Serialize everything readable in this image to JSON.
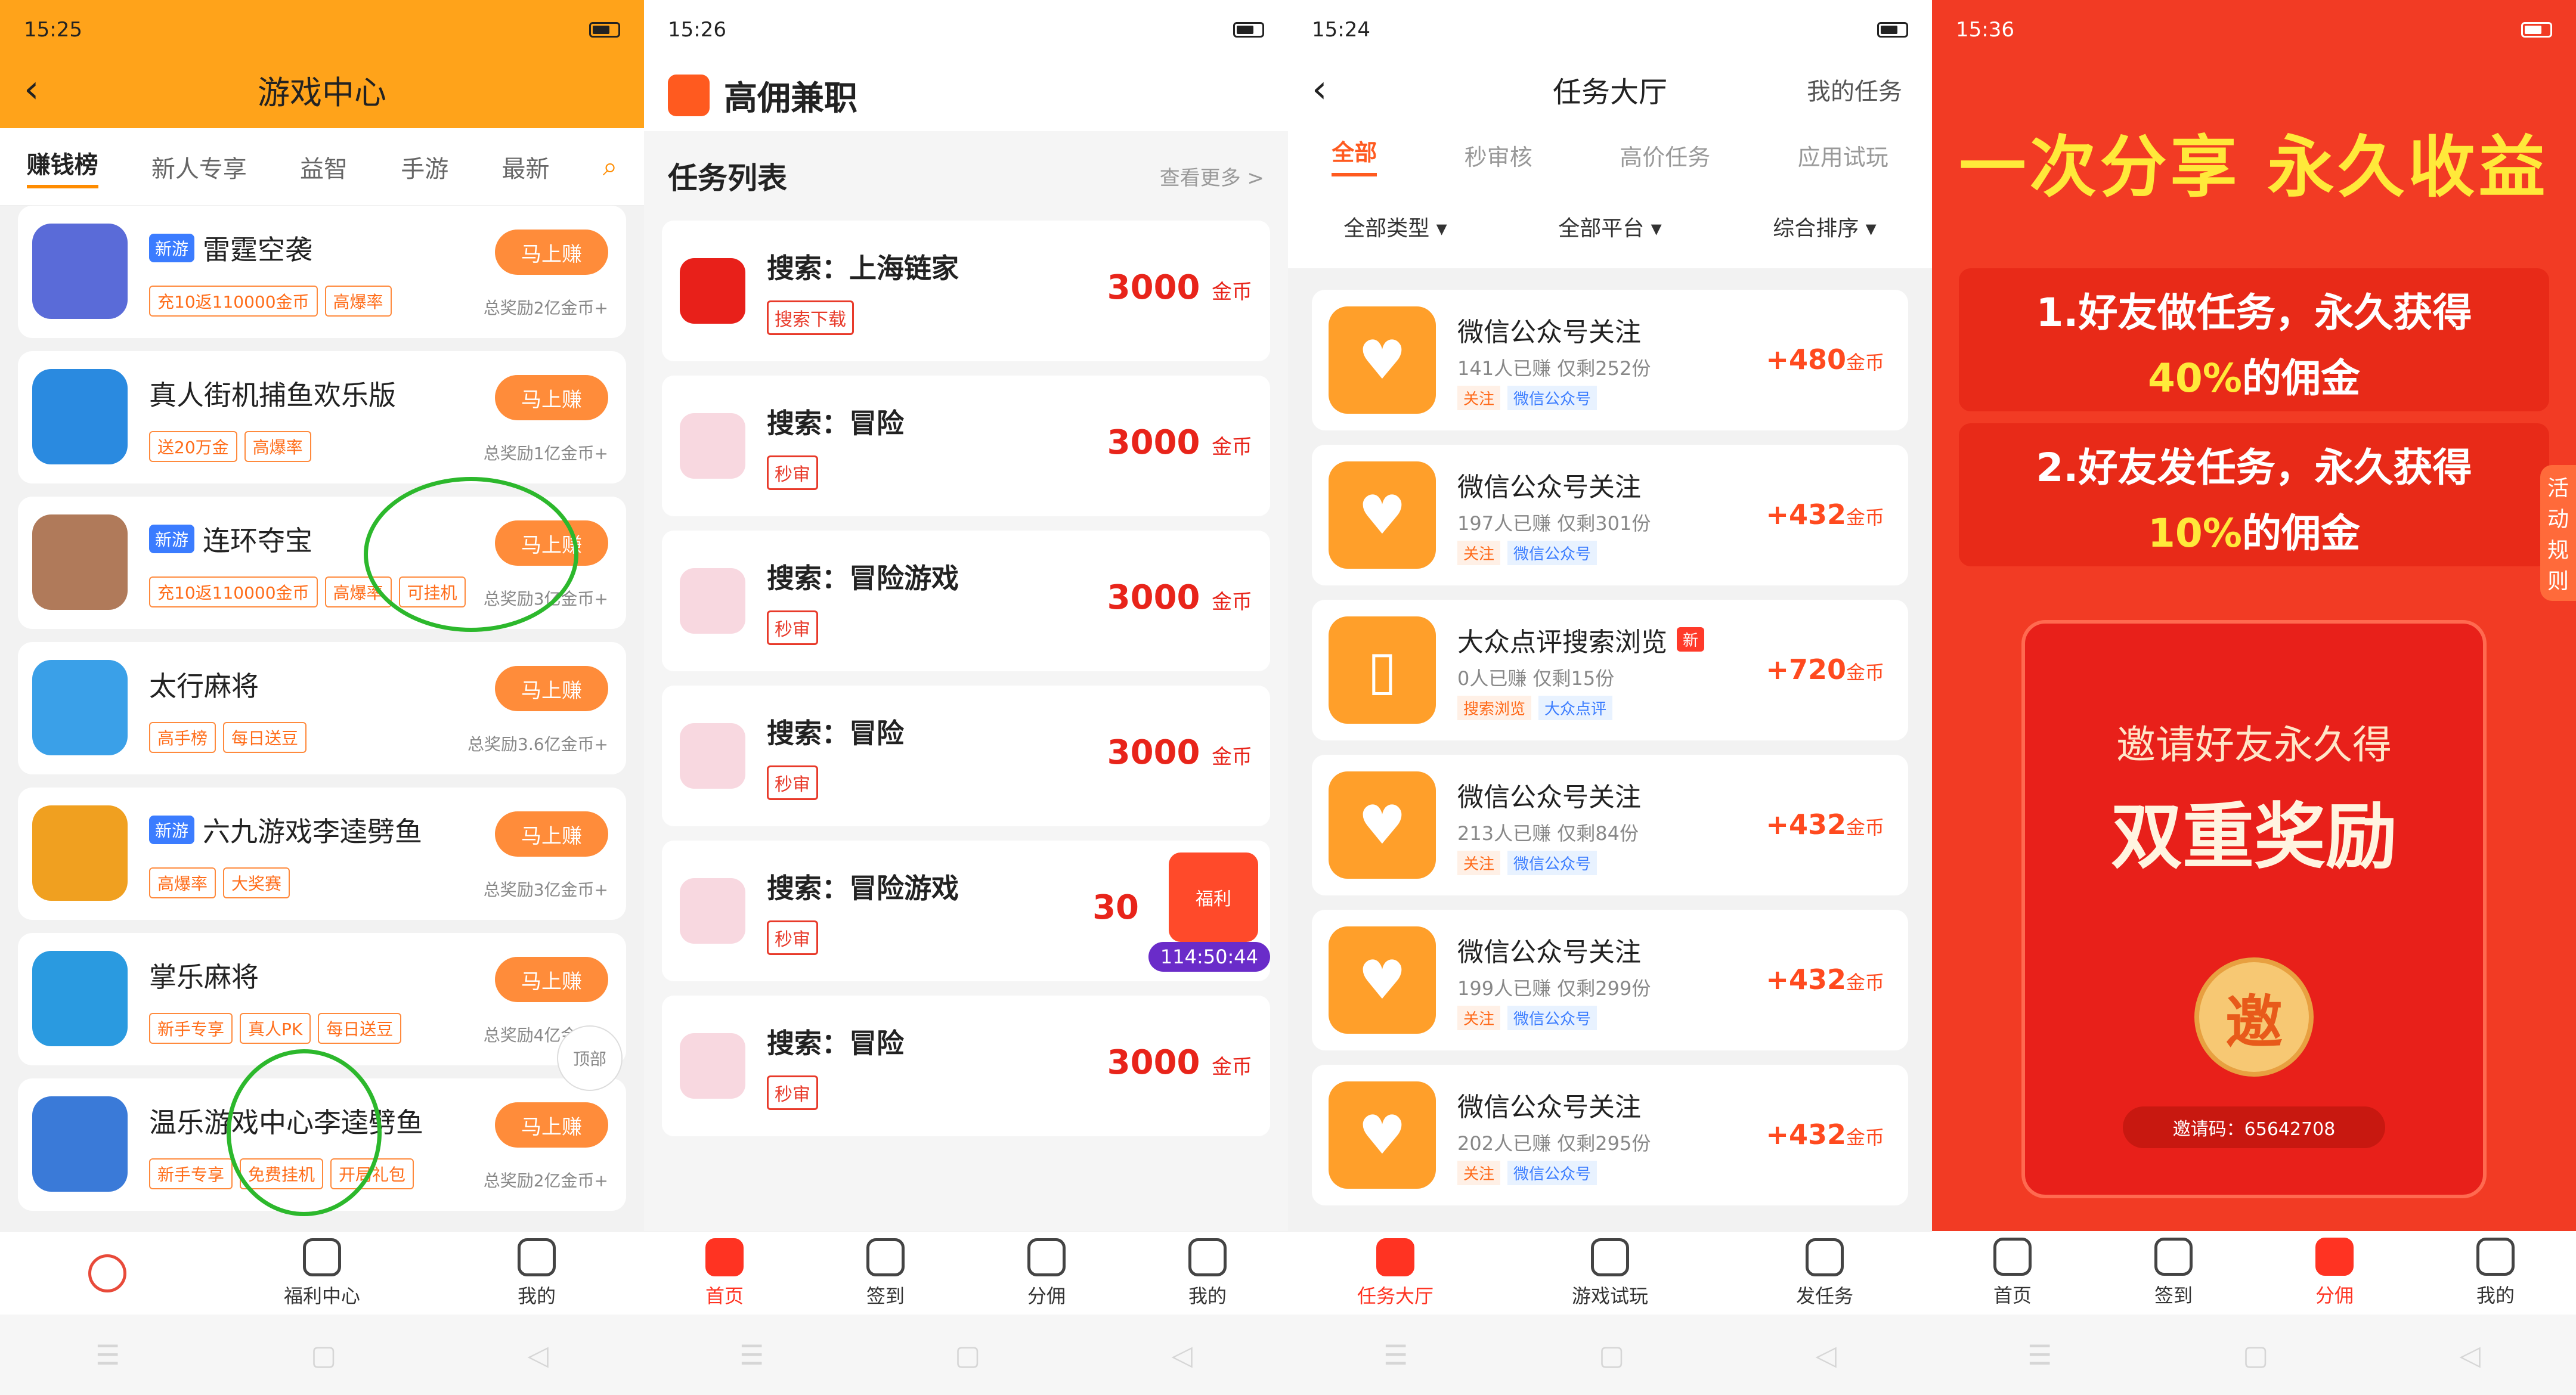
{
  "p1": {
    "status_time": "15:25",
    "title": "游戏中心",
    "tabs": [
      "赚钱榜",
      "新人专享",
      "益智",
      "手游",
      "最新"
    ],
    "games": [
      {
        "name": "雷霆空袭",
        "new": "新游",
        "tags": [
          "充10返110000金币",
          "高爆率"
        ],
        "btn": "马上赚",
        "total": "总奖励2亿金币+"
      },
      {
        "name": "真人街机捕鱼欢乐版",
        "new": "",
        "tags": [
          "送20万金",
          "高爆率"
        ],
        "btn": "马上赚",
        "total": "总奖励1亿金币+"
      },
      {
        "name": "连环夺宝",
        "new": "新游",
        "tags": [
          "充10返110000金币",
          "高爆率",
          "可挂机"
        ],
        "btn": "马上赚",
        "total": "总奖励3亿金币+"
      },
      {
        "name": "太行麻将",
        "new": "",
        "tags": [
          "高手榜",
          "每日送豆"
        ],
        "btn": "马上赚",
        "total": "总奖励3.6亿金币+"
      },
      {
        "name": "六九游戏李逵劈鱼",
        "new": "新游",
        "tags": [
          "高爆率",
          "大奖赛"
        ],
        "btn": "马上赚",
        "total": "总奖励3亿金币+"
      },
      {
        "name": "掌乐麻将",
        "new": "",
        "tags": [
          "新手专享",
          "真人PK",
          "每日送豆"
        ],
        "btn": "马上赚",
        "total": "总奖励4亿金币+"
      },
      {
        "name": "温乐游戏中心李逵劈鱼",
        "new": "",
        "tags": [
          "新手专享",
          "免费挂机",
          "开局礼包"
        ],
        "btn": "马上赚",
        "total": "总奖励2亿金币+"
      }
    ],
    "top_btn": "顶部",
    "nav": [
      "",
      "福利中心",
      "我的"
    ]
  },
  "p2": {
    "status_time": "15:26",
    "app_title": "高佣兼职",
    "section_title": "任务列表",
    "more": "查看更多 >",
    "tasks": [
      {
        "name": "搜索：上海链家",
        "tag": "搜索下载",
        "amount": "3000",
        "unit": "金币"
      },
      {
        "name": "搜索：冒险",
        "tag": "秒审",
        "amount": "3000",
        "unit": "金币"
      },
      {
        "name": "搜索：冒险游戏",
        "tag": "秒审",
        "amount": "3000",
        "unit": "金币"
      },
      {
        "name": "搜索：冒险",
        "tag": "秒审",
        "amount": "3000",
        "unit": "金币"
      },
      {
        "name": "搜索：冒险游戏",
        "tag": "秒审",
        "amount": "30",
        "unit": ""
      },
      {
        "name": "搜索：冒险",
        "tag": "秒审",
        "amount": "3000",
        "unit": "金币"
      }
    ],
    "fuli": "福利",
    "timer": "114:50:44",
    "nav": [
      "首页",
      "签到",
      "分佣",
      "我的"
    ]
  },
  "p3": {
    "status_time": "15:24",
    "title": "任务大厅",
    "right": "我的任务",
    "tabs": [
      "全部",
      "秒审核",
      "高价任务",
      "应用试玩"
    ],
    "filters": [
      "全部类型 ▾",
      "全部平台 ▾",
      "综合排序 ▾"
    ],
    "tasks": [
      {
        "name": "微信公众号关注",
        "new": "",
        "stat": "141人已赚  仅剩252份",
        "t1": "关注",
        "t2": "微信公众号",
        "reward": "+480",
        "unit": "金币"
      },
      {
        "name": "微信公众号关注",
        "new": "",
        "stat": "197人已赚  仅剩301份",
        "t1": "关注",
        "t2": "微信公众号",
        "reward": "+432",
        "unit": "金币"
      },
      {
        "name": "大众点评搜索浏览",
        "new": "新",
        "stat": "0人已赚  仅剩15份",
        "t1": "搜索浏览",
        "t2": "大众点评",
        "reward": "+720",
        "unit": "金币"
      },
      {
        "name": "微信公众号关注",
        "new": "",
        "stat": "213人已赚  仅剩84份",
        "t1": "关注",
        "t2": "微信公众号",
        "reward": "+432",
        "unit": "金币"
      },
      {
        "name": "微信公众号关注",
        "new": "",
        "stat": "199人已赚  仅剩299份",
        "t1": "关注",
        "t2": "微信公众号",
        "reward": "+432",
        "unit": "金币"
      },
      {
        "name": "微信公众号关注",
        "new": "",
        "stat": "202人已赚  仅剩295份",
        "t1": "关注",
        "t2": "微信公众号",
        "reward": "+432",
        "unit": "金币"
      }
    ],
    "nav": [
      "任务大厅",
      "游戏试玩",
      "发任务"
    ]
  },
  "p4": {
    "status_time": "15:36",
    "slogan": "一次分享 永久收益",
    "box1a": "1.好友做任务，永久获得",
    "box1b": "40%",
    "box1c": "的佣金",
    "box2a": "2.好友发任务，永久获得",
    "box2b": "10%",
    "box2c": "的佣金",
    "side": "活动规则",
    "env1": "邀请好友永久得",
    "env2": "双重奖励",
    "coin": "邀",
    "invite": "邀请码：65642708",
    "nav": [
      "首页",
      "签到",
      "分佣",
      "我的"
    ]
  }
}
